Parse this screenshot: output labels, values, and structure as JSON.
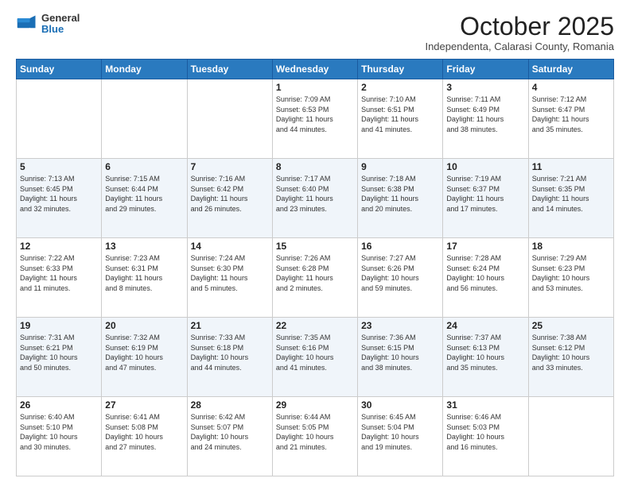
{
  "header": {
    "logo_general": "General",
    "logo_blue": "Blue",
    "month_title": "October 2025",
    "location": "Independenta, Calarasi County, Romania"
  },
  "weekdays": [
    "Sunday",
    "Monday",
    "Tuesday",
    "Wednesday",
    "Thursday",
    "Friday",
    "Saturday"
  ],
  "weeks": [
    [
      {
        "day": "",
        "info": ""
      },
      {
        "day": "",
        "info": ""
      },
      {
        "day": "",
        "info": ""
      },
      {
        "day": "1",
        "info": "Sunrise: 7:09 AM\nSunset: 6:53 PM\nDaylight: 11 hours\nand 44 minutes."
      },
      {
        "day": "2",
        "info": "Sunrise: 7:10 AM\nSunset: 6:51 PM\nDaylight: 11 hours\nand 41 minutes."
      },
      {
        "day": "3",
        "info": "Sunrise: 7:11 AM\nSunset: 6:49 PM\nDaylight: 11 hours\nand 38 minutes."
      },
      {
        "day": "4",
        "info": "Sunrise: 7:12 AM\nSunset: 6:47 PM\nDaylight: 11 hours\nand 35 minutes."
      }
    ],
    [
      {
        "day": "5",
        "info": "Sunrise: 7:13 AM\nSunset: 6:45 PM\nDaylight: 11 hours\nand 32 minutes."
      },
      {
        "day": "6",
        "info": "Sunrise: 7:15 AM\nSunset: 6:44 PM\nDaylight: 11 hours\nand 29 minutes."
      },
      {
        "day": "7",
        "info": "Sunrise: 7:16 AM\nSunset: 6:42 PM\nDaylight: 11 hours\nand 26 minutes."
      },
      {
        "day": "8",
        "info": "Sunrise: 7:17 AM\nSunset: 6:40 PM\nDaylight: 11 hours\nand 23 minutes."
      },
      {
        "day": "9",
        "info": "Sunrise: 7:18 AM\nSunset: 6:38 PM\nDaylight: 11 hours\nand 20 minutes."
      },
      {
        "day": "10",
        "info": "Sunrise: 7:19 AM\nSunset: 6:37 PM\nDaylight: 11 hours\nand 17 minutes."
      },
      {
        "day": "11",
        "info": "Sunrise: 7:21 AM\nSunset: 6:35 PM\nDaylight: 11 hours\nand 14 minutes."
      }
    ],
    [
      {
        "day": "12",
        "info": "Sunrise: 7:22 AM\nSunset: 6:33 PM\nDaylight: 11 hours\nand 11 minutes."
      },
      {
        "day": "13",
        "info": "Sunrise: 7:23 AM\nSunset: 6:31 PM\nDaylight: 11 hours\nand 8 minutes."
      },
      {
        "day": "14",
        "info": "Sunrise: 7:24 AM\nSunset: 6:30 PM\nDaylight: 11 hours\nand 5 minutes."
      },
      {
        "day": "15",
        "info": "Sunrise: 7:26 AM\nSunset: 6:28 PM\nDaylight: 11 hours\nand 2 minutes."
      },
      {
        "day": "16",
        "info": "Sunrise: 7:27 AM\nSunset: 6:26 PM\nDaylight: 10 hours\nand 59 minutes."
      },
      {
        "day": "17",
        "info": "Sunrise: 7:28 AM\nSunset: 6:24 PM\nDaylight: 10 hours\nand 56 minutes."
      },
      {
        "day": "18",
        "info": "Sunrise: 7:29 AM\nSunset: 6:23 PM\nDaylight: 10 hours\nand 53 minutes."
      }
    ],
    [
      {
        "day": "19",
        "info": "Sunrise: 7:31 AM\nSunset: 6:21 PM\nDaylight: 10 hours\nand 50 minutes."
      },
      {
        "day": "20",
        "info": "Sunrise: 7:32 AM\nSunset: 6:19 PM\nDaylight: 10 hours\nand 47 minutes."
      },
      {
        "day": "21",
        "info": "Sunrise: 7:33 AM\nSunset: 6:18 PM\nDaylight: 10 hours\nand 44 minutes."
      },
      {
        "day": "22",
        "info": "Sunrise: 7:35 AM\nSunset: 6:16 PM\nDaylight: 10 hours\nand 41 minutes."
      },
      {
        "day": "23",
        "info": "Sunrise: 7:36 AM\nSunset: 6:15 PM\nDaylight: 10 hours\nand 38 minutes."
      },
      {
        "day": "24",
        "info": "Sunrise: 7:37 AM\nSunset: 6:13 PM\nDaylight: 10 hours\nand 35 minutes."
      },
      {
        "day": "25",
        "info": "Sunrise: 7:38 AM\nSunset: 6:12 PM\nDaylight: 10 hours\nand 33 minutes."
      }
    ],
    [
      {
        "day": "26",
        "info": "Sunrise: 6:40 AM\nSunset: 5:10 PM\nDaylight: 10 hours\nand 30 minutes."
      },
      {
        "day": "27",
        "info": "Sunrise: 6:41 AM\nSunset: 5:08 PM\nDaylight: 10 hours\nand 27 minutes."
      },
      {
        "day": "28",
        "info": "Sunrise: 6:42 AM\nSunset: 5:07 PM\nDaylight: 10 hours\nand 24 minutes."
      },
      {
        "day": "29",
        "info": "Sunrise: 6:44 AM\nSunset: 5:05 PM\nDaylight: 10 hours\nand 21 minutes."
      },
      {
        "day": "30",
        "info": "Sunrise: 6:45 AM\nSunset: 5:04 PM\nDaylight: 10 hours\nand 19 minutes."
      },
      {
        "day": "31",
        "info": "Sunrise: 6:46 AM\nSunset: 5:03 PM\nDaylight: 10 hours\nand 16 minutes."
      },
      {
        "day": "",
        "info": ""
      }
    ]
  ]
}
